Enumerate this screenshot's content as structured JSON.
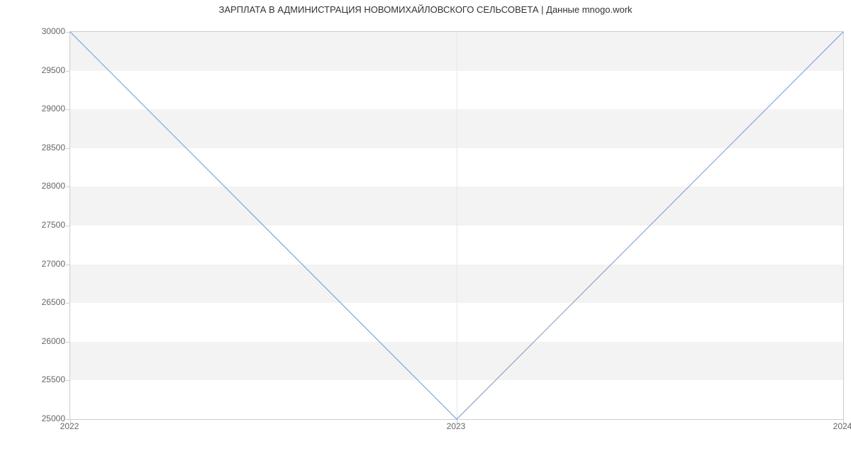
{
  "chart_data": {
    "type": "line",
    "title": "ЗАРПЛАТА В АДМИНИСТРАЦИЯ НОВОМИХАЙЛОВСКОГО СЕЛЬСОВЕТА | Данные mnogo.work",
    "x": [
      "2022",
      "2023",
      "2024"
    ],
    "values": [
      30000,
      25000,
      30000
    ],
    "xlabel": "",
    "ylabel": "",
    "ylim": [
      25000,
      30000
    ],
    "y_ticks": [
      25000,
      25500,
      26000,
      26500,
      27000,
      27500,
      28000,
      28500,
      29000,
      29500,
      30000
    ],
    "line_color": "#7297c9"
  }
}
